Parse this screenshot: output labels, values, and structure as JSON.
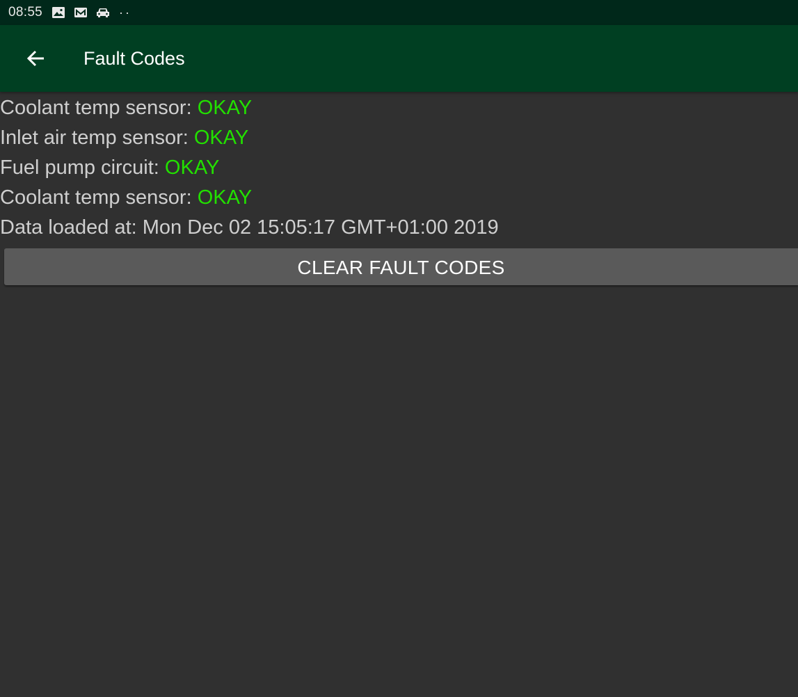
{
  "status_bar": {
    "time": "08:55",
    "icons": [
      "image-icon",
      "mail-icon",
      "car-icon"
    ],
    "more": "··"
  },
  "app_bar": {
    "title": "Fault Codes",
    "back_icon": "arrow-back-icon"
  },
  "faults": [
    {
      "label": "Coolant temp sensor: ",
      "status": "OKAY"
    },
    {
      "label": "Inlet air temp sensor: ",
      "status": "OKAY"
    },
    {
      "label": "Fuel pump circuit: ",
      "status": "OKAY"
    },
    {
      "label": "Coolant temp sensor: ",
      "status": "OKAY"
    }
  ],
  "data_loaded": "Data loaded at: Mon Dec 02 15:05:17 GMT+01:00 2019",
  "clear_button_label": "CLEAR FAULT CODES",
  "colors": {
    "status_bar": "#00281a",
    "app_bar": "#003f22",
    "background": "#303030",
    "ok_status": "#22e000",
    "button": "#5a5a5a"
  }
}
